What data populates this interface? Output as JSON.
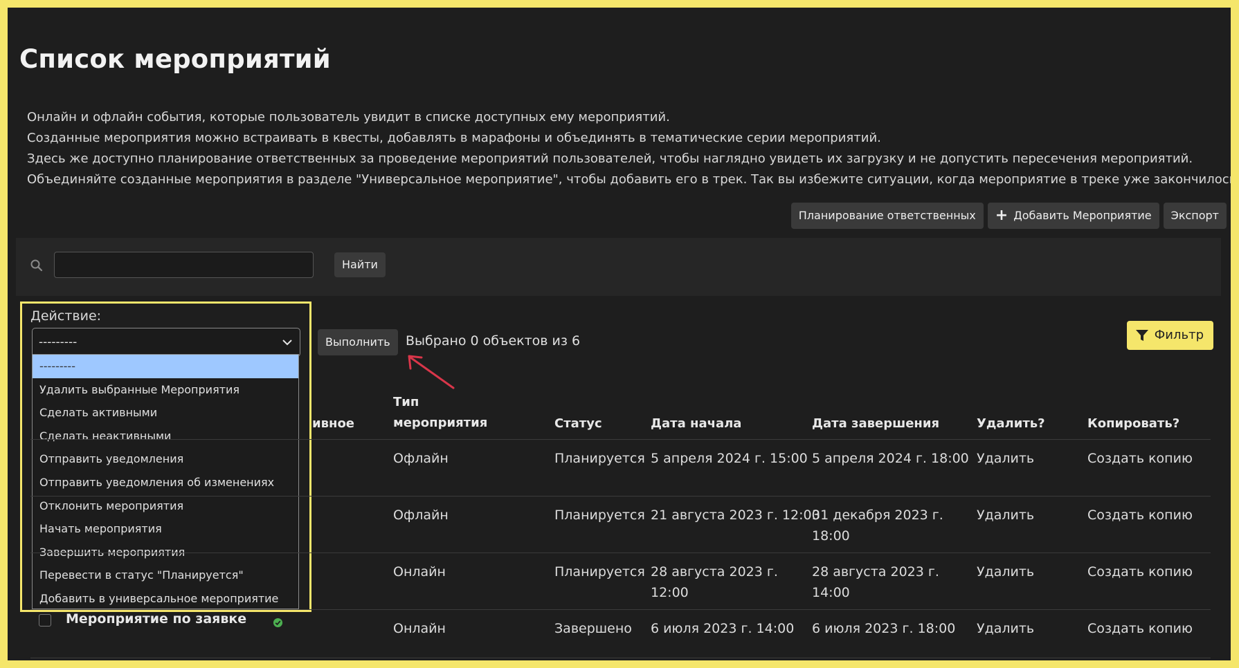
{
  "page": {
    "title": "Список мероприятий",
    "description": [
      "Онлайн и офлайн события, которые пользователь увидит в списке доступных ему мероприятий.",
      "Созданные мероприятия можно встраивать в квесты, добавлять в марафоны и объединять в тематические серии мероприятий.",
      "Здесь же доступно планирование ответственных за проведение мероприятий пользователей, чтобы наглядно увидеть их загрузку и не допустить пересечения мероприятий.",
      "Объединяйте созданные мероприятия в разделе \"Универсальное мероприятие\", чтобы добавить его в трек. Так вы избежите ситуации, когда мероприятие в треке уже закончилось."
    ]
  },
  "toolbar": {
    "plan_label": "Планирование ответственных",
    "add_label": "Добавить Мероприятие",
    "export_label": "Экспорт"
  },
  "search": {
    "value": "",
    "find_label": "Найти"
  },
  "actions": {
    "label": "Действие:",
    "selected": "---------",
    "options": [
      "---------",
      "Удалить выбранные Мероприятия",
      "Сделать активными",
      "Сделать неактивными",
      "Отправить уведомления",
      "Отправить уведомления об изменениях",
      "Отклонить мероприятия",
      "Начать мероприятия",
      "Завершить мероприятия",
      "Перевести в статус \"Планируется\"",
      "Добавить в универсальное мероприятие"
    ],
    "run_label": "Выполнить",
    "selected_count": "Выбрано 0 объектов из 6"
  },
  "filter": {
    "label": "Фильтр"
  },
  "table": {
    "headers": {
      "active_partial": "ивное",
      "type_line1": "Тип",
      "type_line2": "мероприятия",
      "status": "Статус",
      "start": "Дата начала",
      "end": "Дата завершения",
      "delete": "Удалить?",
      "copy": "Копировать?"
    },
    "rows": [
      {
        "type": "Офлайн",
        "status": "Планируется",
        "start_1": "5 апреля 2024 г. 15:00",
        "start_2": "",
        "end_1": "5 апреля 2024 г. 18:00",
        "end_2": "",
        "delete": "Удалить",
        "copy": "Создать копию"
      },
      {
        "type": "Офлайн",
        "status": "Планируется",
        "start_1": "21 августа 2023 г. 12:00",
        "start_2": "",
        "end_1": "31 декабря 2023 г.",
        "end_2": "18:00",
        "delete": "Удалить",
        "copy": "Создать копию"
      },
      {
        "type": "Онлайн",
        "status": "Планируется",
        "start_1": "28 августа 2023 г.",
        "start_2": "12:00",
        "end_1": "28 августа 2023 г.",
        "end_2": "14:00",
        "delete": "Удалить",
        "copy": "Создать копию"
      },
      {
        "name": "Мероприятие по заявке",
        "type": "Онлайн",
        "status": "Завершено",
        "start_1": "6 июля 2023 г. 14:00",
        "start_2": "",
        "end_1": "6 июля 2023 г. 18:00",
        "end_2": "",
        "delete": "Удалить",
        "copy": "Создать копию"
      }
    ]
  },
  "colors": {
    "accent": "#f5e66b",
    "background": "#1e1e1e",
    "selected_option": "#9ec8ff",
    "annotation_arrow": "#d9364a",
    "active_check": "#4caf50"
  },
  "icons": {
    "search": "search-icon",
    "plus": "plus-icon",
    "chevron": "chevron-down-icon",
    "filter": "filter-icon",
    "check": "check-circle-icon",
    "arrow": "annotation-arrow"
  }
}
